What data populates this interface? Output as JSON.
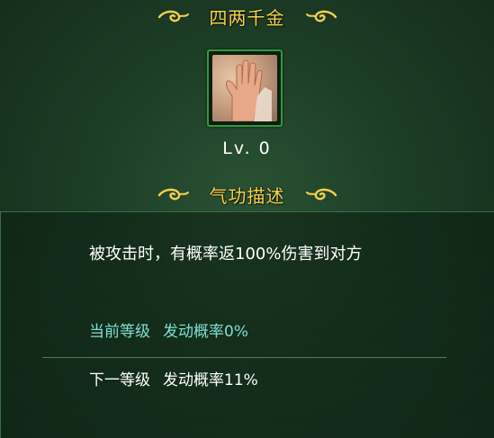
{
  "skill": {
    "name": "四两千金",
    "level": "Lv. 0",
    "icon": "open-palm-icon"
  },
  "description_section": {
    "title": "气功描述",
    "text": "被攻击时，有概率返100%伤害到对方",
    "current_level_label": "当前等级",
    "current_level_effect": "发动概率0%",
    "next_level_label": "下一等级",
    "next_level_effect": "发动概率11%"
  },
  "colors": {
    "title_gold": "#f6d24a",
    "current_cyan": "#7fe0d2",
    "frame_green": "#2f9a3c",
    "background": "#1d3d26"
  }
}
